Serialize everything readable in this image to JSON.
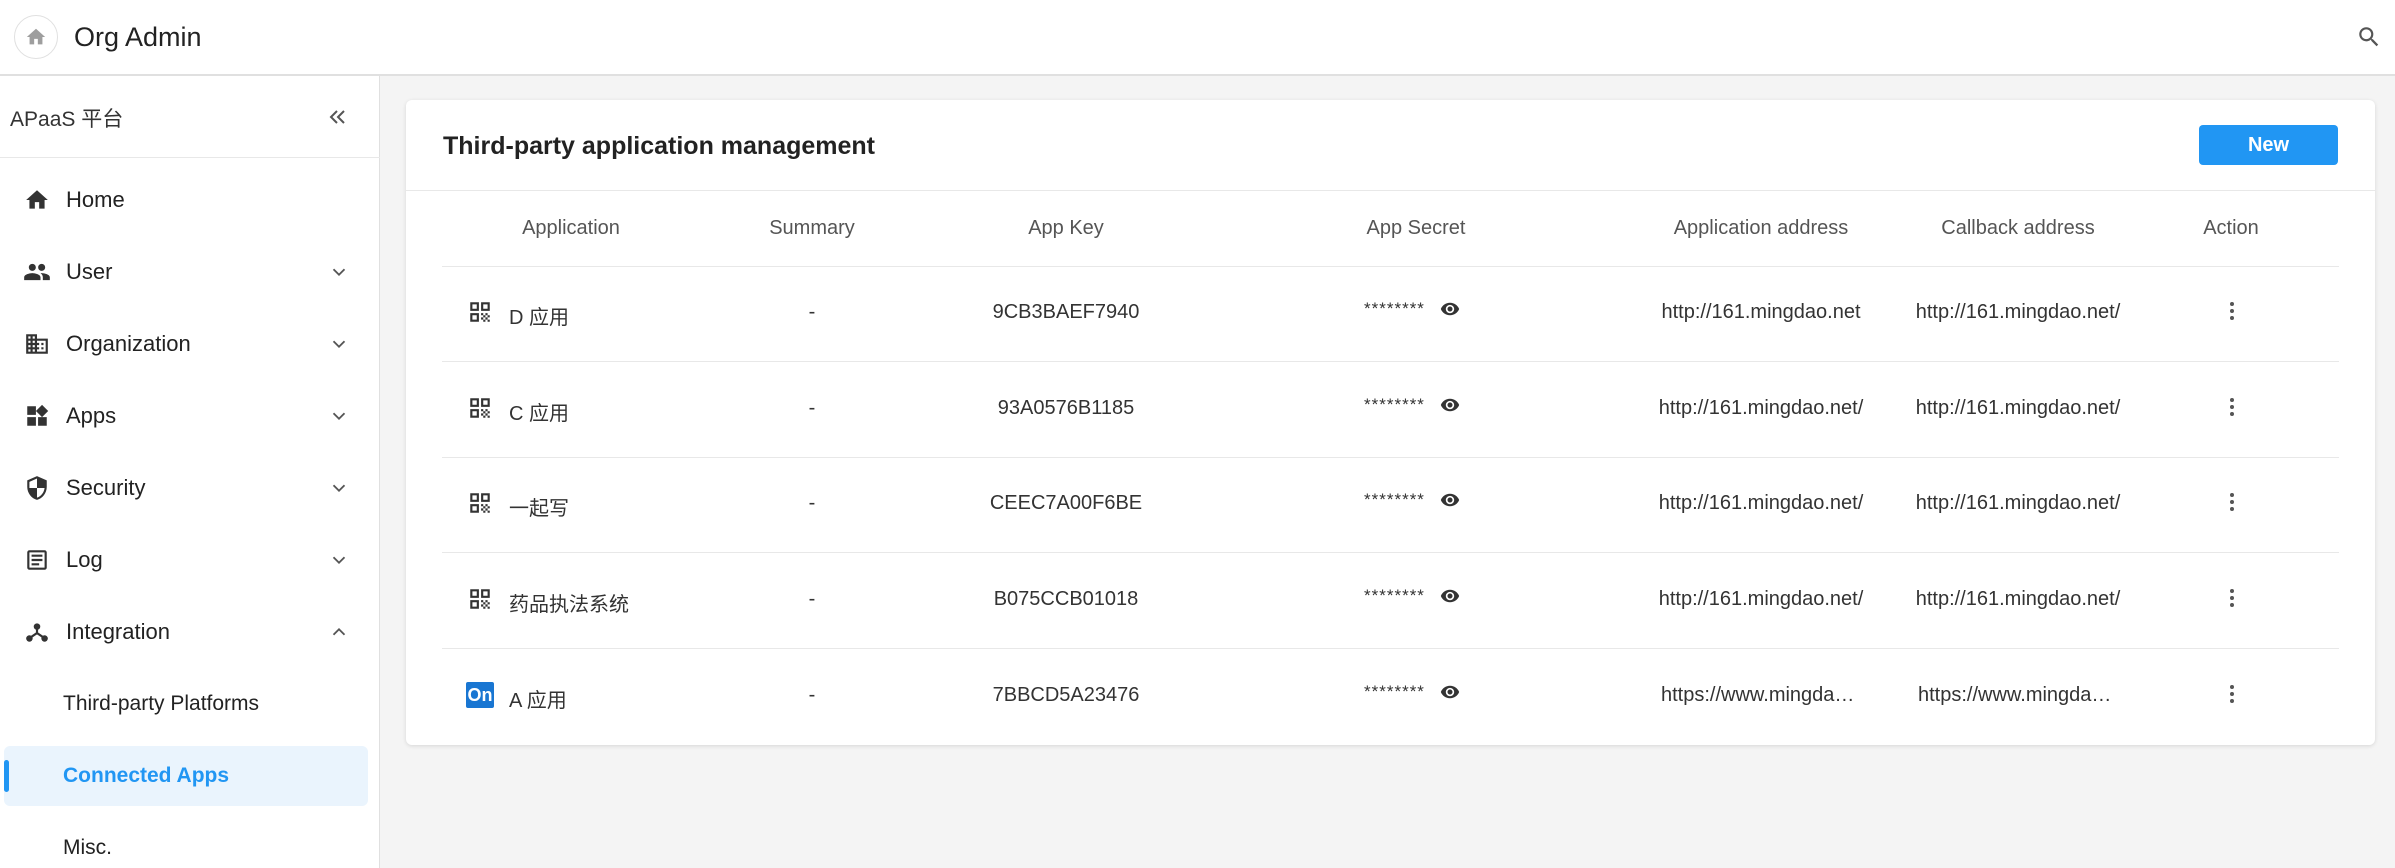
{
  "topbar": {
    "title": "Org Admin"
  },
  "sidebar": {
    "title": "APaaS 平台",
    "items": [
      {
        "label": "Home"
      },
      {
        "label": "User"
      },
      {
        "label": "Organization"
      },
      {
        "label": "Apps"
      },
      {
        "label": "Security"
      },
      {
        "label": "Log"
      },
      {
        "label": "Integration"
      }
    ],
    "sub_items": [
      {
        "label": "Third-party Platforms"
      },
      {
        "label": "Connected Apps"
      },
      {
        "label": "Misc."
      }
    ]
  },
  "main": {
    "title": "Third-party application management",
    "new_label": "New",
    "columns": [
      "Application",
      "Summary",
      "App Key",
      "App Secret",
      "Application address",
      "Callback address",
      "Action"
    ],
    "rows": [
      {
        "name": "D 应用",
        "icon": "qr-code-icon",
        "summary": "-",
        "app_key": "9CB3BAEF7940",
        "secret": "********",
        "app_address": "http://161.mingdao.net",
        "callback": "http://161.mingdao.net/"
      },
      {
        "name": "C 应用",
        "icon": "qr-code-icon",
        "summary": "-",
        "app_key": "93A0576B1185",
        "secret": "********",
        "app_address": "http://161.mingdao.net/",
        "callback": "http://161.mingdao.net/"
      },
      {
        "name": "一起写",
        "icon": "qr-code-icon",
        "summary": "-",
        "app_key": "CEEC7A00F6BE",
        "secret": "********",
        "app_address": "http://161.mingdao.net/",
        "callback": "http://161.mingdao.net/"
      },
      {
        "name": "药品执法系统",
        "icon": "qr-code-icon",
        "summary": "-",
        "app_key": "B075CCB01018",
        "secret": "********",
        "app_address": "http://161.mingdao.net/",
        "callback": "http://161.mingdao.net/"
      },
      {
        "name": "A 应用",
        "icon": "on-logo-icon",
        "logo_text": "On",
        "summary": "-",
        "app_key": "7BBCD5A23476",
        "secret": "********",
        "app_address": "https://www.mingdao.com/",
        "callback": "https://www.mingdao.com/"
      }
    ]
  },
  "colors": {
    "accent": "#2196f3",
    "active_bg": "#eaf4fd"
  }
}
